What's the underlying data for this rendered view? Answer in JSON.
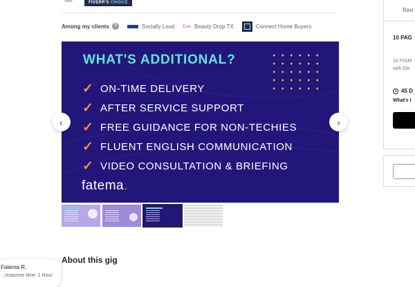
{
  "badge": {
    "part1": "FIVERR'S",
    "part2": "CHOICE"
  },
  "clients": {
    "label": "Among my clients",
    "items": [
      {
        "name": "Socially Loud",
        "icon": "socially-loud-logo"
      },
      {
        "name": "Beauty Drop TX",
        "icon": "beauty-drop-logo",
        "logo_text": "Lau"
      },
      {
        "name": "Connect Home Buyers",
        "icon": "connect-home-buyers-logo"
      }
    ]
  },
  "hero": {
    "title": "WHAT'S ADDITIONAL?",
    "items": [
      "ON-TIME DELIVERY",
      "AFTER SERVICE SUPPORT",
      "FREE GUIDANCE FOR NON-TECHIES",
      "FLUENT ENGLISH COMMUNICATION",
      "VIDEO CONSULTATION & BRIEFING"
    ],
    "brand": "fatema",
    "brand_dot": ".",
    "colors": {
      "background": "#23167a",
      "title": "#5ee8dc",
      "check": "#ff8a3d",
      "dots": "#f7b733"
    }
  },
  "gallery": {
    "prev_icon": "‹",
    "next_icon": "›",
    "thumbnails": [
      "thumbnail-1",
      "thumbnail-2",
      "thumbnail-3",
      "thumbnail-4"
    ],
    "selected_index": 2
  },
  "about": {
    "title": "About this gig"
  },
  "seller": {
    "name": "Fatema R.",
    "subtitle": "...response time: 1 Hour"
  },
  "package": {
    "tab": "Basi",
    "title": "10 PAG",
    "desc_line1": "10 FIGM",
    "desc_line2": "with Ele",
    "delivery": "45 D",
    "whats": "What's I"
  }
}
